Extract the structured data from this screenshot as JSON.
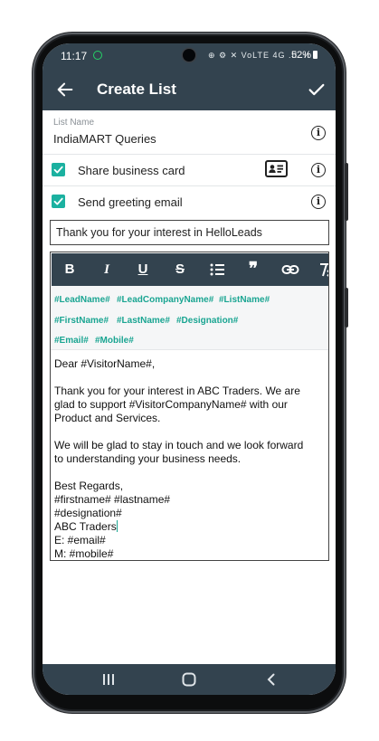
{
  "status_bar": {
    "time": "11:17",
    "icons_text": "⊕ ⚙ ✕ VoLTE 4G .ıl .ıl",
    "battery": "52%"
  },
  "app_bar": {
    "title": "Create List",
    "back_icon": "arrow-left-icon",
    "confirm_icon": "check-icon"
  },
  "form": {
    "list_name_label": "List Name",
    "list_name_value": "IndiaMART Queries",
    "share_business_card": {
      "label": "Share business card",
      "checked": true
    },
    "send_greeting_email": {
      "label": "Send greeting email",
      "checked": true
    },
    "subject": "Thank you for your interest in HelloLeads"
  },
  "editor": {
    "toolbar": [
      "bold-icon",
      "italic-icon",
      "underline-icon",
      "strikethrough-icon",
      "bulleted-list-icon",
      "quote-icon",
      "link-icon",
      "clear-format-icon"
    ],
    "toolbar_glyphs": {
      "bold": "B",
      "italic": "I",
      "underline": "U",
      "strike": "S",
      "quote": "❞"
    },
    "tags": [
      "#LeadName#",
      "#LeadCompanyName#",
      "#ListName#",
      "#FirstName#",
      "#LastName#",
      "#Designation#",
      "#Email#",
      "#Mobile#"
    ],
    "body_lines": [
      "Dear #VisitorName#,",
      "",
      "Thank you for your interest in ABC Traders. We are",
      "glad to support #VisitorCompanyName# with our",
      "Product and Services.",
      "",
      "We will be glad to stay in touch and we look forward",
      "to understanding your business needs.",
      "",
      "Best Regards,",
      "#firstname# #lastname#",
      "#designation#",
      "ABC Traders",
      "E: #email#",
      "M: #mobile#"
    ]
  },
  "nav_bar": [
    "recents-icon",
    "home-icon",
    "back-icon"
  ],
  "colors": {
    "app_bar": "#33434f",
    "accent_teal": "#1bb1a0",
    "tag_green": "#1aa592",
    "text": "#222222"
  }
}
